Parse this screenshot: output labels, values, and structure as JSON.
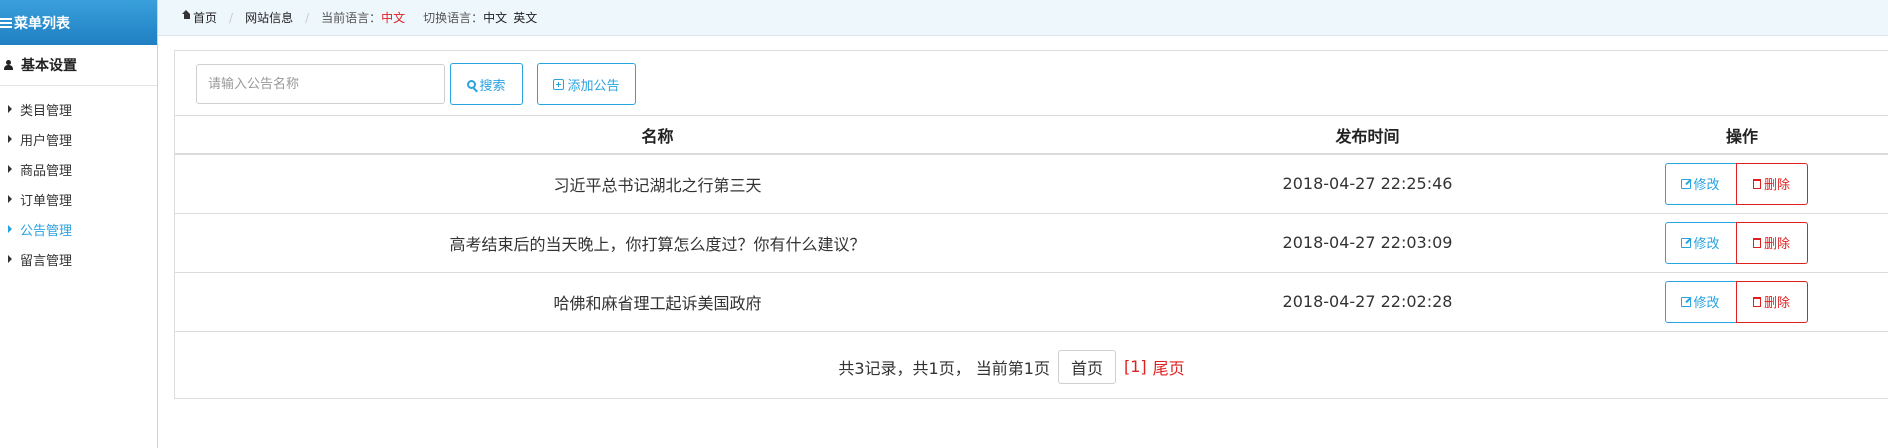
{
  "sidebar": {
    "title": "菜单列表",
    "group": "基本设置",
    "items": [
      {
        "label": "类目管理"
      },
      {
        "label": "用户管理"
      },
      {
        "label": "商品管理"
      },
      {
        "label": "订单管理"
      },
      {
        "label": "公告管理",
        "active": true
      },
      {
        "label": "留言管理"
      }
    ]
  },
  "breadcrumb": {
    "home": "首页",
    "site": "网站信息",
    "current_lang_label": "当前语言：",
    "current_lang": "中文",
    "switch_label": "切换语言：",
    "lang_zh": "中文",
    "lang_en": "英文"
  },
  "toolbar": {
    "search_placeholder": "请输入公告名称",
    "search_value": "",
    "search_label": "搜索",
    "add_label": "添加公告"
  },
  "table": {
    "headers": [
      "名称",
      "发布时间",
      "操作"
    ],
    "rows": [
      {
        "name": "习近平总书记湖北之行第三天",
        "time": "2018-04-27 22:25:46"
      },
      {
        "name": "高考结束后的当天晚上，你打算怎么度过？你有什么建议？",
        "time": "2018-04-27 22:03:09"
      },
      {
        "name": "哈佛和麻省理工起诉美国政府",
        "time": "2018-04-27 22:02:28"
      }
    ],
    "edit_label": "修改",
    "delete_label": "删除"
  },
  "pagination": {
    "summary": "共3记录，共1页，  当前第1页",
    "first_label": "首页",
    "current_page": "[1]",
    "last_label": "尾页"
  },
  "colors": {
    "accent": "#29a3e0",
    "danger": "#e02020",
    "sidebar_header": "#2d8fd0"
  }
}
